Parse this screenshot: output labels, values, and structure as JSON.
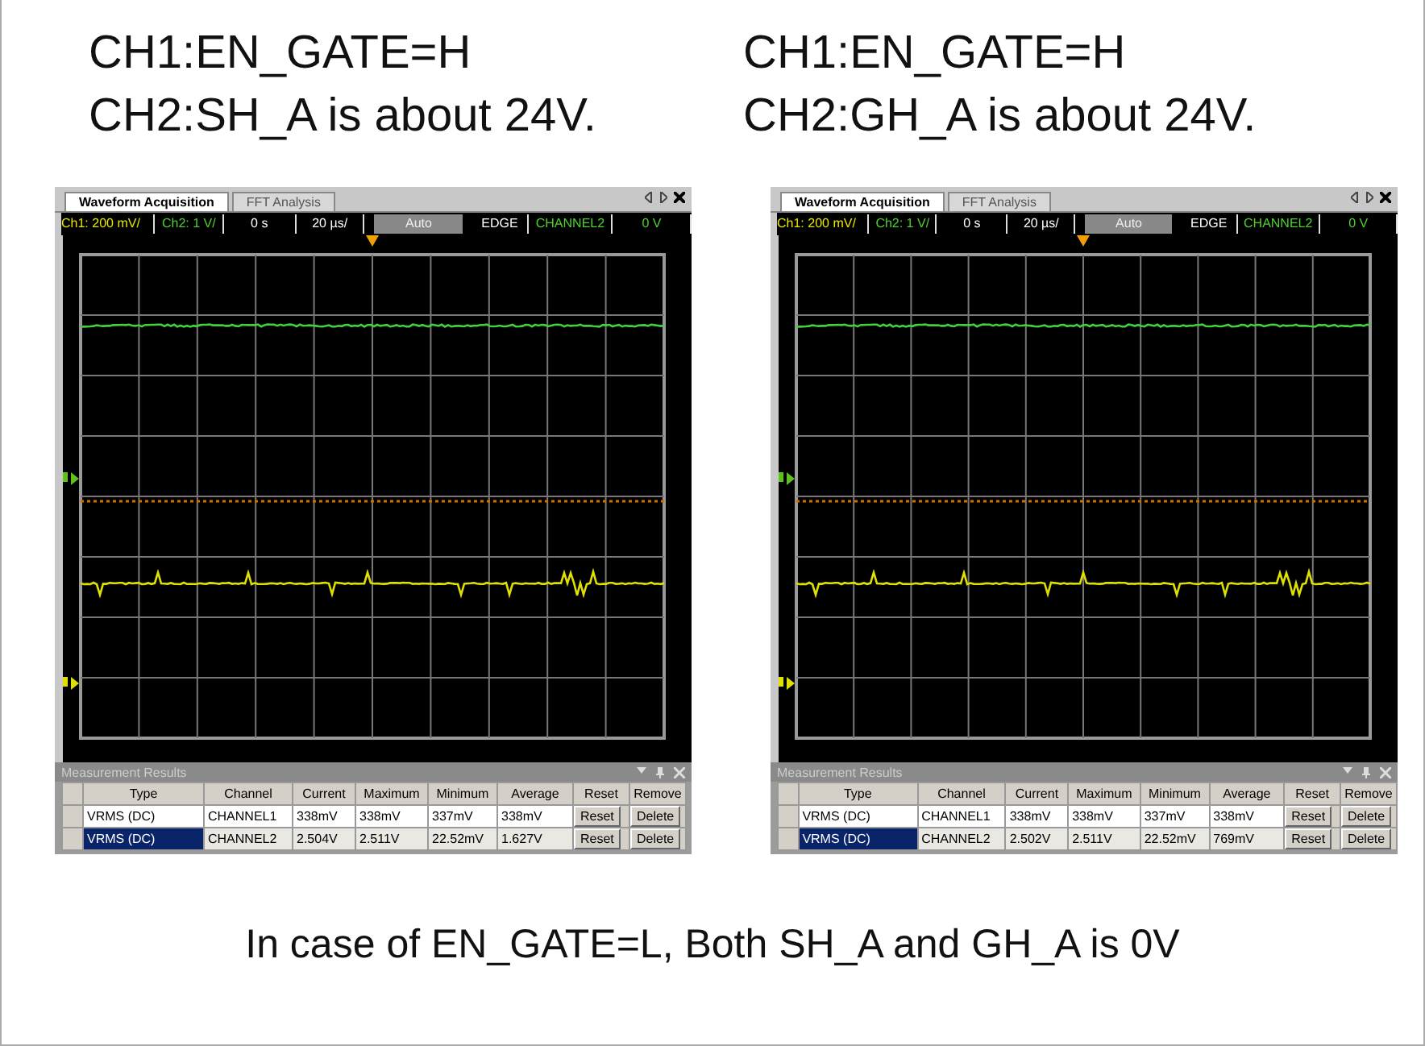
{
  "headings": [
    {
      "lines": [
        "CH1:EN_GATE=H",
        "CH2:SH_A is about 24V."
      ]
    },
    {
      "lines": [
        "CH1:EN_GATE=H",
        "CH2:GH_A is about 24V."
      ]
    }
  ],
  "scopes": [
    {
      "tabs": [
        {
          "label": "Waveform Acquisition",
          "selected": true
        },
        {
          "label": "FFT Analysis",
          "selected": false
        }
      ],
      "status": [
        {
          "text": "Ch1: 200 mV/",
          "kind": "ch1"
        },
        {
          "text": "Ch2: 1 V/",
          "kind": "ch2"
        },
        {
          "text": "0 s",
          "kind": "plain"
        },
        {
          "text": "20 µs/",
          "kind": "plain"
        },
        {
          "text": "Auto",
          "kind": "button"
        },
        {
          "text": "EDGE",
          "kind": "plain"
        },
        {
          "text": "CHANNEL2",
          "kind": "ch2"
        },
        {
          "text": "0 V",
          "kind": "ch2"
        }
      ],
      "measurements": {
        "title": "Measurement Results",
        "columns": [
          "Type",
          "Channel",
          "Current",
          "Maximum",
          "Minimum",
          "Average",
          "Reset",
          "Remove"
        ],
        "rows": [
          {
            "type": "VRMS (DC)",
            "values": [
              "CHANNEL1",
              "338mV",
              "338mV",
              "337mV",
              "338mV"
            ],
            "buttons": [
              "Reset",
              "Delete"
            ],
            "selected": false
          },
          {
            "type": "VRMS (DC)",
            "values": [
              "CHANNEL2",
              "2.504V",
              "2.511V",
              "22.52mV",
              "1.627V"
            ],
            "buttons": [
              "Reset",
              "Delete"
            ],
            "selected": true
          }
        ]
      }
    },
    {
      "tabs": [
        {
          "label": "Waveform Acquisition",
          "selected": true
        },
        {
          "label": "FFT Analysis",
          "selected": false
        }
      ],
      "status": [
        {
          "text": "Ch1: 200 mV/",
          "kind": "ch1"
        },
        {
          "text": "Ch2: 1 V/",
          "kind": "ch2"
        },
        {
          "text": "0 s",
          "kind": "plain"
        },
        {
          "text": "20 µs/",
          "kind": "plain"
        },
        {
          "text": "Auto",
          "kind": "button"
        },
        {
          "text": "EDGE",
          "kind": "plain"
        },
        {
          "text": "CHANNEL2",
          "kind": "ch2"
        },
        {
          "text": "0 V",
          "kind": "ch2"
        }
      ],
      "measurements": {
        "title": "Measurement Results",
        "columns": [
          "Type",
          "Channel",
          "Current",
          "Maximum",
          "Minimum",
          "Average",
          "Reset",
          "Remove"
        ],
        "rows": [
          {
            "type": "VRMS (DC)",
            "values": [
              "CHANNEL1",
              "338mV",
              "338mV",
              "337mV",
              "338mV"
            ],
            "buttons": [
              "Reset",
              "Delete"
            ],
            "selected": false
          },
          {
            "type": "VRMS (DC)",
            "values": [
              "CHANNEL2",
              "2.502V",
              "2.511V",
              "22.52mV",
              "769mV"
            ],
            "buttons": [
              "Reset",
              "Delete"
            ],
            "selected": true
          }
        ]
      }
    }
  ],
  "footer": "In case of EN_GATE=L, Both SH_A and GH_A is 0V"
}
